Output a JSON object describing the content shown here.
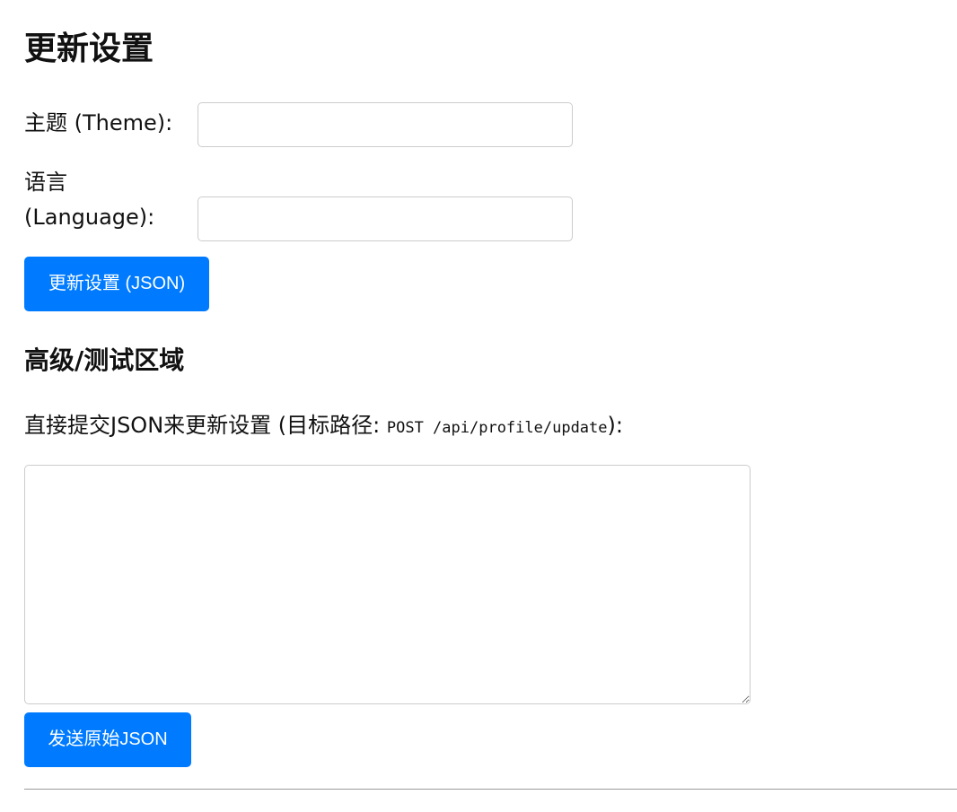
{
  "page": {
    "title": "更新设置"
  },
  "settings_form": {
    "theme": {
      "label": "主题 (Theme):",
      "value": "",
      "placeholder": ""
    },
    "language": {
      "label": "语言 (Language):",
      "value": "",
      "placeholder": ""
    },
    "submit_label": "更新设置 (JSON)"
  },
  "advanced": {
    "title": "高级/测试区域",
    "instructions_prefix": "直接提交JSON来更新设置 (目标路径: ",
    "endpoint": "POST /api/profile/update",
    "instructions_suffix": "):",
    "json_value": "",
    "send_label": "发送原始JSON"
  },
  "colors": {
    "button_background": "#007bff",
    "button_text": "#ffffff",
    "input_border": "#cccccc",
    "divider": "#9a9a9a"
  }
}
